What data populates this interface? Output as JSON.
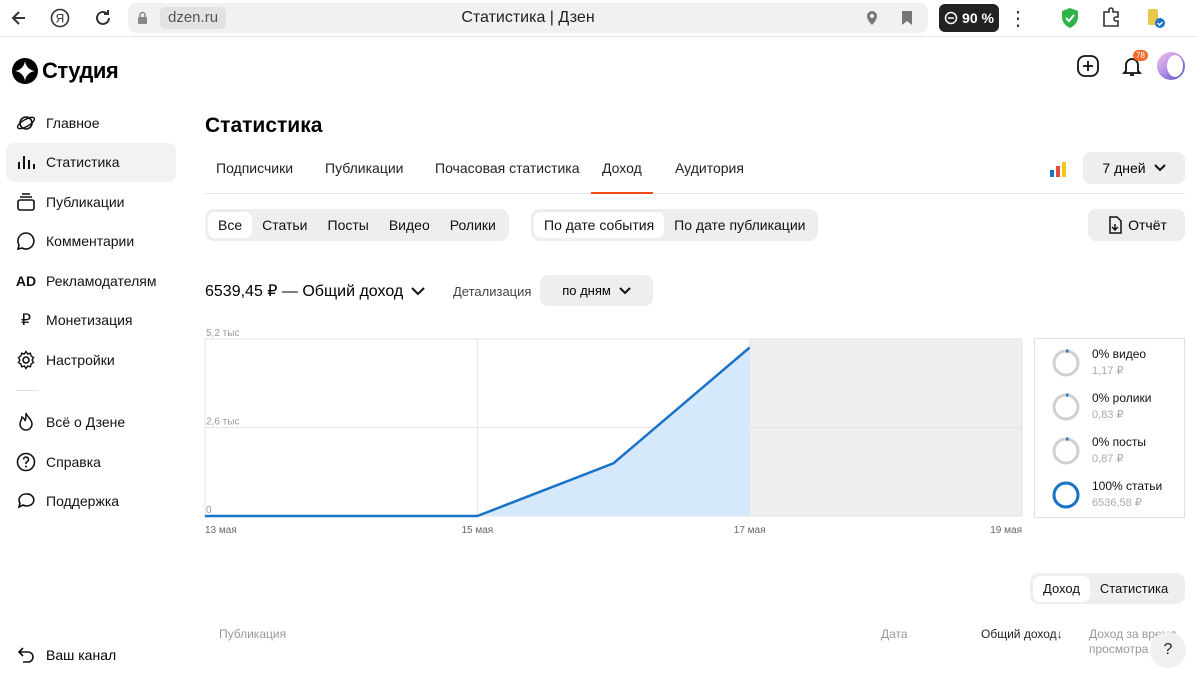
{
  "browser": {
    "domain": "dzen.ru",
    "page_title": "Статистика | Дзен",
    "zoom": "90 %",
    "notifications_count": "78"
  },
  "brand": {
    "name": "Студия"
  },
  "sidebar": {
    "items": [
      {
        "label": "Главное",
        "icon": "planet-icon"
      },
      {
        "label": "Статистика",
        "icon": "bar-chart-icon",
        "active": true
      },
      {
        "label": "Публикации",
        "icon": "stack-icon"
      },
      {
        "label": "Комментарии",
        "icon": "comment-icon"
      },
      {
        "label": "Рекламодателям",
        "icon": "ad-icon",
        "icon_text": "AD"
      },
      {
        "label": "Монетизация",
        "icon": "ruble-icon",
        "icon_text": "₽"
      },
      {
        "label": "Настройки",
        "icon": "gear-icon"
      }
    ],
    "secondary": [
      {
        "label": "Всё о Дзене",
        "icon": "flame-icon"
      },
      {
        "label": "Справка",
        "icon": "help-icon"
      },
      {
        "label": "Поддержка",
        "icon": "chat-icon"
      }
    ],
    "bottom": {
      "label": "Ваш канал",
      "icon": "back-arrow-icon"
    }
  },
  "main": {
    "title": "Статистика",
    "tabs": [
      "Подписчики",
      "Публикации",
      "Почасовая статистика",
      "Доход",
      "Аудитория"
    ],
    "active_tab": "Доход",
    "period": "7 дней",
    "content_filter": [
      "Все",
      "Статьи",
      "Посты",
      "Видео",
      "Ролики"
    ],
    "date_filter": [
      "По дате события",
      "По дате публикации"
    ],
    "report_label": "Отчёт",
    "total_label": "6539,45 ₽ — Общий доход",
    "detail_label": "Детализация",
    "detail_value": "по дням",
    "accent_color": "#f24b1a",
    "line_color": "#1a73c9"
  },
  "chart_data": {
    "type": "area",
    "x": [
      "13 мая",
      "14 мая",
      "15 мая",
      "16 мая",
      "17 мая"
    ],
    "values": [
      0,
      0,
      0,
      1550,
      4950
    ],
    "ylim": [
      0,
      5200
    ],
    "y_ticks": [
      "0",
      "2,6 тыс",
      "5,2 тыс"
    ],
    "x_tick_labels": [
      "13 мая",
      "15 мая",
      "17 мая",
      "19 мая"
    ],
    "shaded_future_from": "17 мая",
    "grid": true
  },
  "legend": [
    {
      "main": "0% видео",
      "sub": "1,17 ₽",
      "fraction": 0.0
    },
    {
      "main": "0% ролики",
      "sub": "0,83 ₽",
      "fraction": 0.0
    },
    {
      "main": "0% посты",
      "sub": "0,87 ₽",
      "fraction": 0.0
    },
    {
      "main": "100% статьи",
      "sub": "6536,58 ₽",
      "fraction": 1.0
    }
  ],
  "bottom": {
    "toggle": [
      "Доход",
      "Статистика"
    ],
    "columns": [
      "Публикация",
      "Дата",
      "Общий доход",
      "Доход за время просмотра"
    ]
  }
}
